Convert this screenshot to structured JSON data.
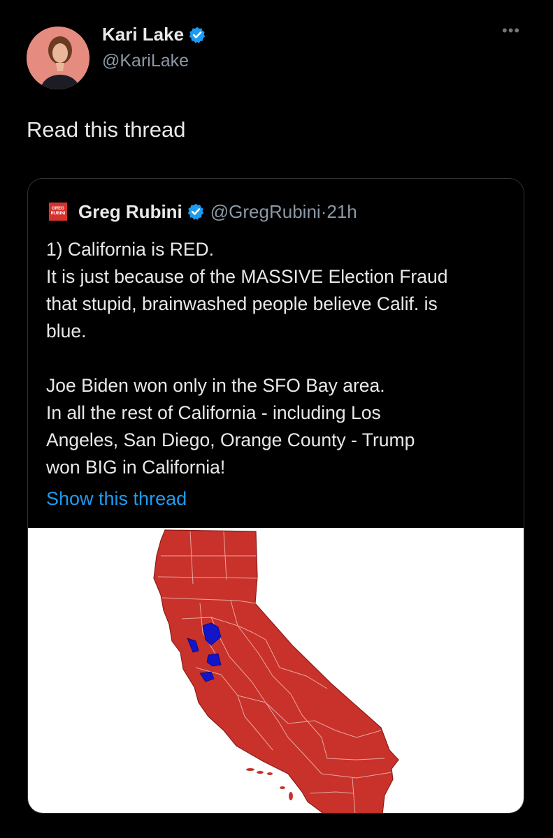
{
  "author": {
    "name": "Kari Lake",
    "handle": "@KariLake",
    "verified_icon": "verified-badge-icon",
    "avatar_icon": "profile-avatar"
  },
  "more_icon": "more-options-icon",
  "tweet": {
    "text": "Read this thread"
  },
  "quote": {
    "logo_line1": "GREG",
    "logo_line2": "RUBINI",
    "name": "Greg Rubini",
    "handle": "@GregRubini",
    "separator": "·",
    "time": "21h",
    "lines": [
      "1) California is RED.",
      "It is just because of the MASSIVE Election Fraud",
      "that stupid, brainwashed people believe Calif. is",
      "blue.",
      "",
      "Joe Biden won only in the SFO Bay area.",
      "In all the rest of California - including Los",
      "Angeles, San Diego, Orange County - Trump",
      "won BIG in California!"
    ],
    "show_thread": "Show this thread",
    "map": {
      "subject": "California county map",
      "red_color": "#c8322b",
      "blue_color": "#1414c8"
    }
  }
}
